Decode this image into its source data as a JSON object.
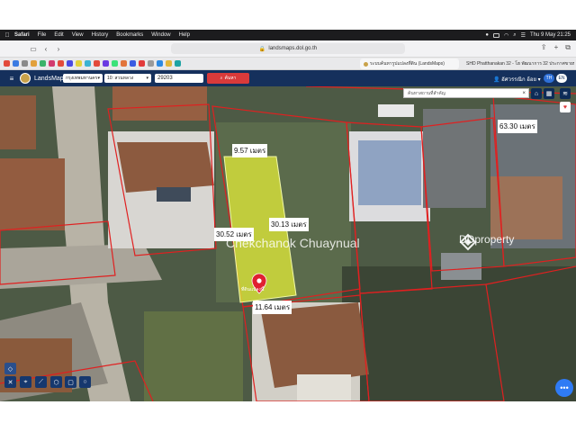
{
  "menubar": {
    "app": "Safari",
    "items": [
      "File",
      "Edit",
      "View",
      "History",
      "Bookmarks",
      "Window",
      "Help"
    ],
    "clock": "Thu 9 May  21:25"
  },
  "browser": {
    "url": "landsmaps.dol.go.th",
    "tabs": [
      {
        "label": "ระบบค้นหารูปแปลงที่ดิน (LandsMaps)"
      },
      {
        "label": "SHD Phatthanakan 32 - โฮ พัฒนาการ 32 ประกาศขายบ้าน..."
      }
    ]
  },
  "app": {
    "brand": "LandsMaps",
    "province": "กรุงเทพมหานคร",
    "district": "10: สวนหลวง",
    "parcel_no": "29203",
    "search_label": "ค้นหา",
    "user": "อัศวรรณิก อ้อย",
    "lang_th": "TH",
    "lang_en": "EN"
  },
  "map": {
    "search_placeholder": "ค้นหาสถานที่สำคัญ",
    "measurements": {
      "top": "9.57 เมตร",
      "right": "30.13 เมตร",
      "left": "30.52 เมตร",
      "bottom": "11.64 เมตร",
      "corner": "63.30 เมตร"
    },
    "parcel_caption": "ที่ดินแปลงนี้",
    "watermark": "Chekchanok Chuaynual",
    "ddproperty": "DDproperty",
    "parcel_color": "#d8e23a",
    "boundary_color": "#e02020",
    "marker_color": "#e02030"
  }
}
